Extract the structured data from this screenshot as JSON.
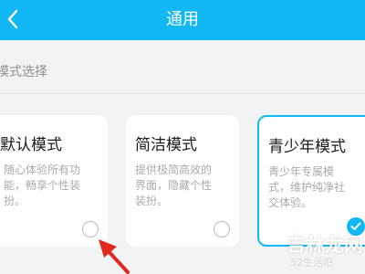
{
  "header": {
    "title": "通用",
    "back_icon": "back-chevron-icon"
  },
  "section": {
    "label": "模式选择"
  },
  "modes": [
    {
      "title": "默认模式",
      "description": "随心体验所有功能，畅享个性装扮。",
      "selected": false
    },
    {
      "title": "简洁模式",
      "description": "提供极简高效的界面，隐藏个性装扮。",
      "selected": false
    },
    {
      "title": "青少年模式",
      "description": "青少年专属模式，维护纯净社交体验。",
      "selected": true
    }
  ],
  "watermark": {
    "text": "吉林龙网",
    "subtext": "52生活吧"
  },
  "colors": {
    "accent": "#12b7f5",
    "background": "#f2f3f5",
    "annotation_arrow": "#e0281e"
  }
}
